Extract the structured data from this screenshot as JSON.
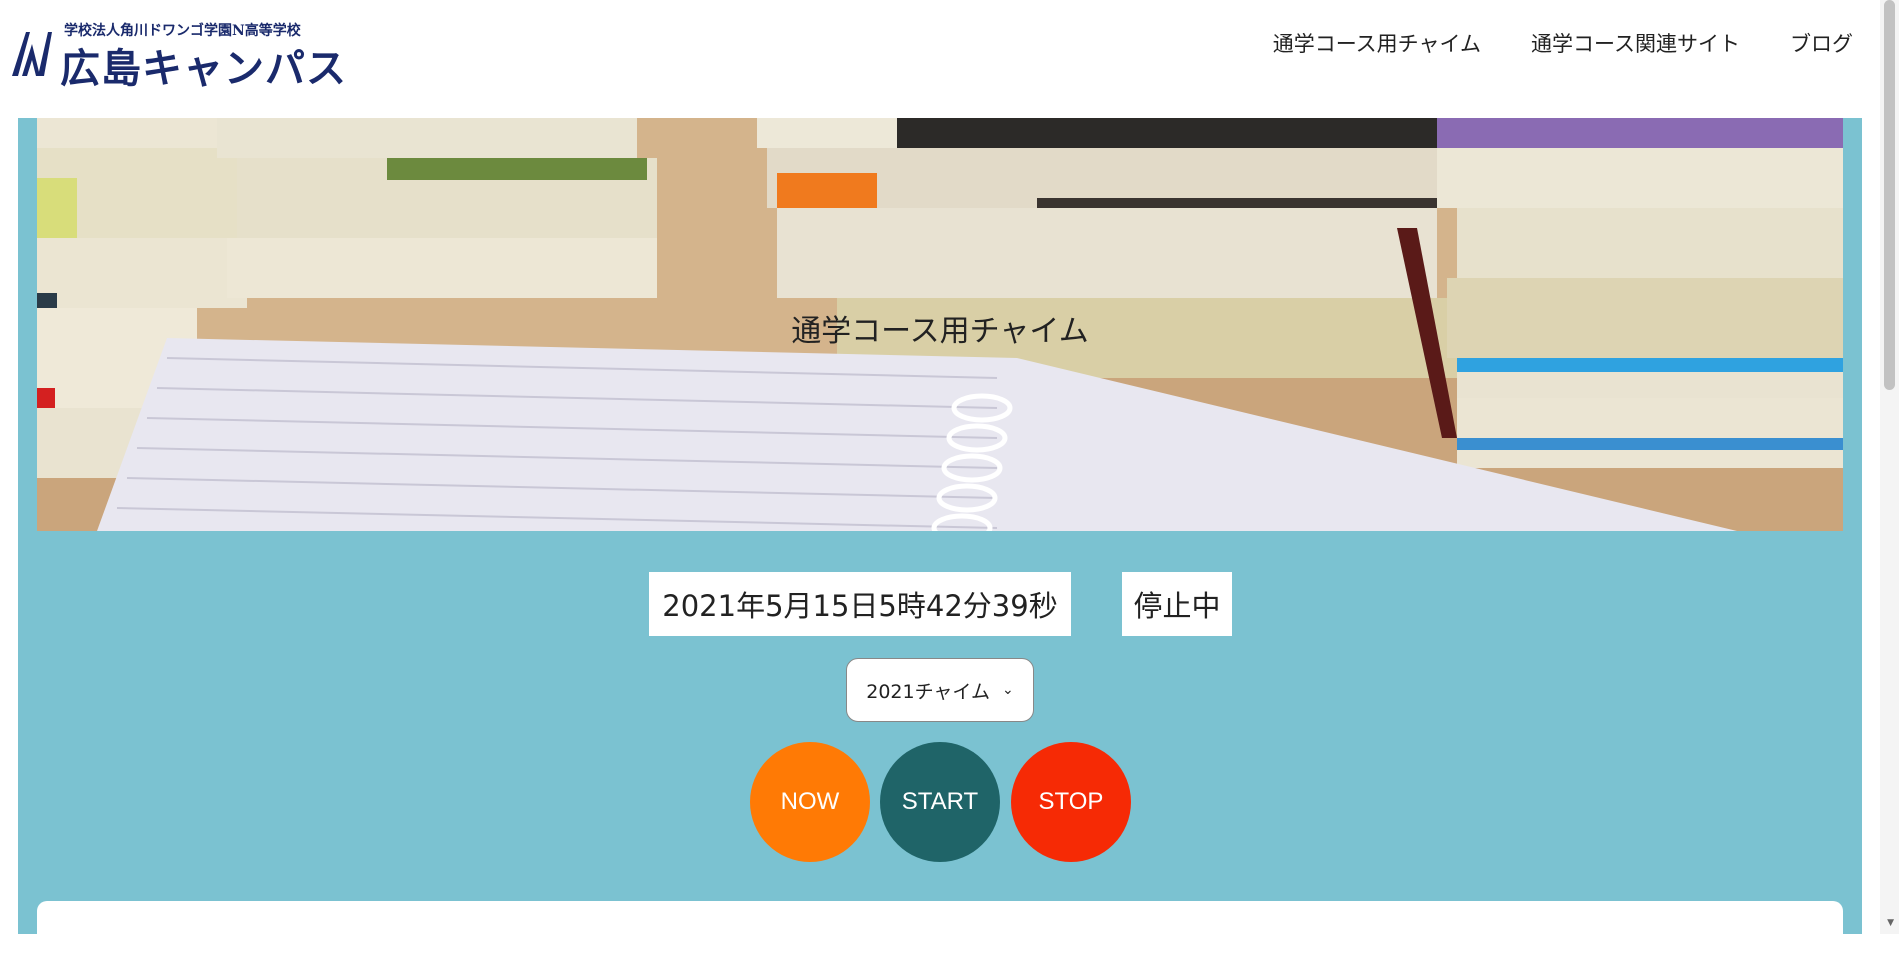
{
  "header": {
    "logo_sub": "学校法人角川ドワンゴ学園N高等学校",
    "logo_main": "広島キャンパス",
    "nav": [
      {
        "label": "通学コース用チャイム"
      },
      {
        "label": "通学コース関連サイト"
      },
      {
        "label": "ブログ"
      }
    ]
  },
  "hero": {
    "title": "通学コース用チャイム"
  },
  "clock": {
    "datetime": "2021年5月15日5時42分39秒",
    "status": "停止中"
  },
  "chime_select": {
    "selected": "2021チャイム",
    "options": [
      "2021チャイム"
    ]
  },
  "buttons": {
    "now": "NOW",
    "start": "START",
    "stop": "STOP"
  },
  "colors": {
    "teal_bg": "#7bc2d1",
    "now": "#ff7a05",
    "start": "#1f6468",
    "stop": "#f62a05",
    "logo": "#1a2a6c"
  },
  "icons": {
    "logo_mark": "n-school-logo-icon",
    "select_chevron": "chevron-down-icon"
  }
}
